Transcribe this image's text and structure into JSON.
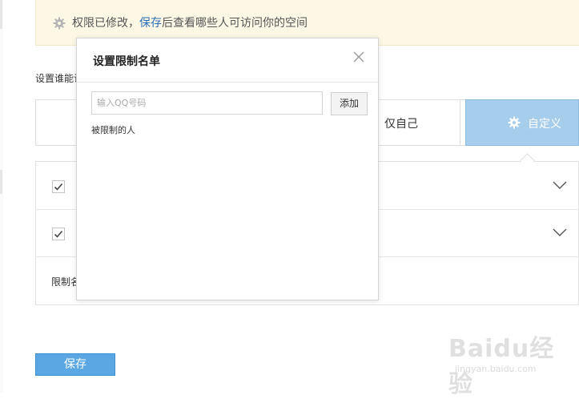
{
  "notice": {
    "text_before": "权限已修改，",
    "link": "保存",
    "text_after": "后查看哪些人可访问你的空间"
  },
  "section_label": "设置谁能访",
  "options": {
    "self_only": "仅自己",
    "custom": "自定义"
  },
  "restrict_list_label": "限制名",
  "save_label": "保存",
  "modal": {
    "title": "设置限制名单",
    "input_placeholder": "输入QQ号码",
    "add_label": "添加",
    "restricted_label": "被限制的人"
  },
  "watermark": {
    "brand": "Baidu经验",
    "site": "jingyan.baidu.com"
  },
  "colors": {
    "accent": "#5aa7e4",
    "selected_option": "#a6cdec",
    "notice_bg": "#fdf8e6",
    "link": "#2b6fb6"
  }
}
